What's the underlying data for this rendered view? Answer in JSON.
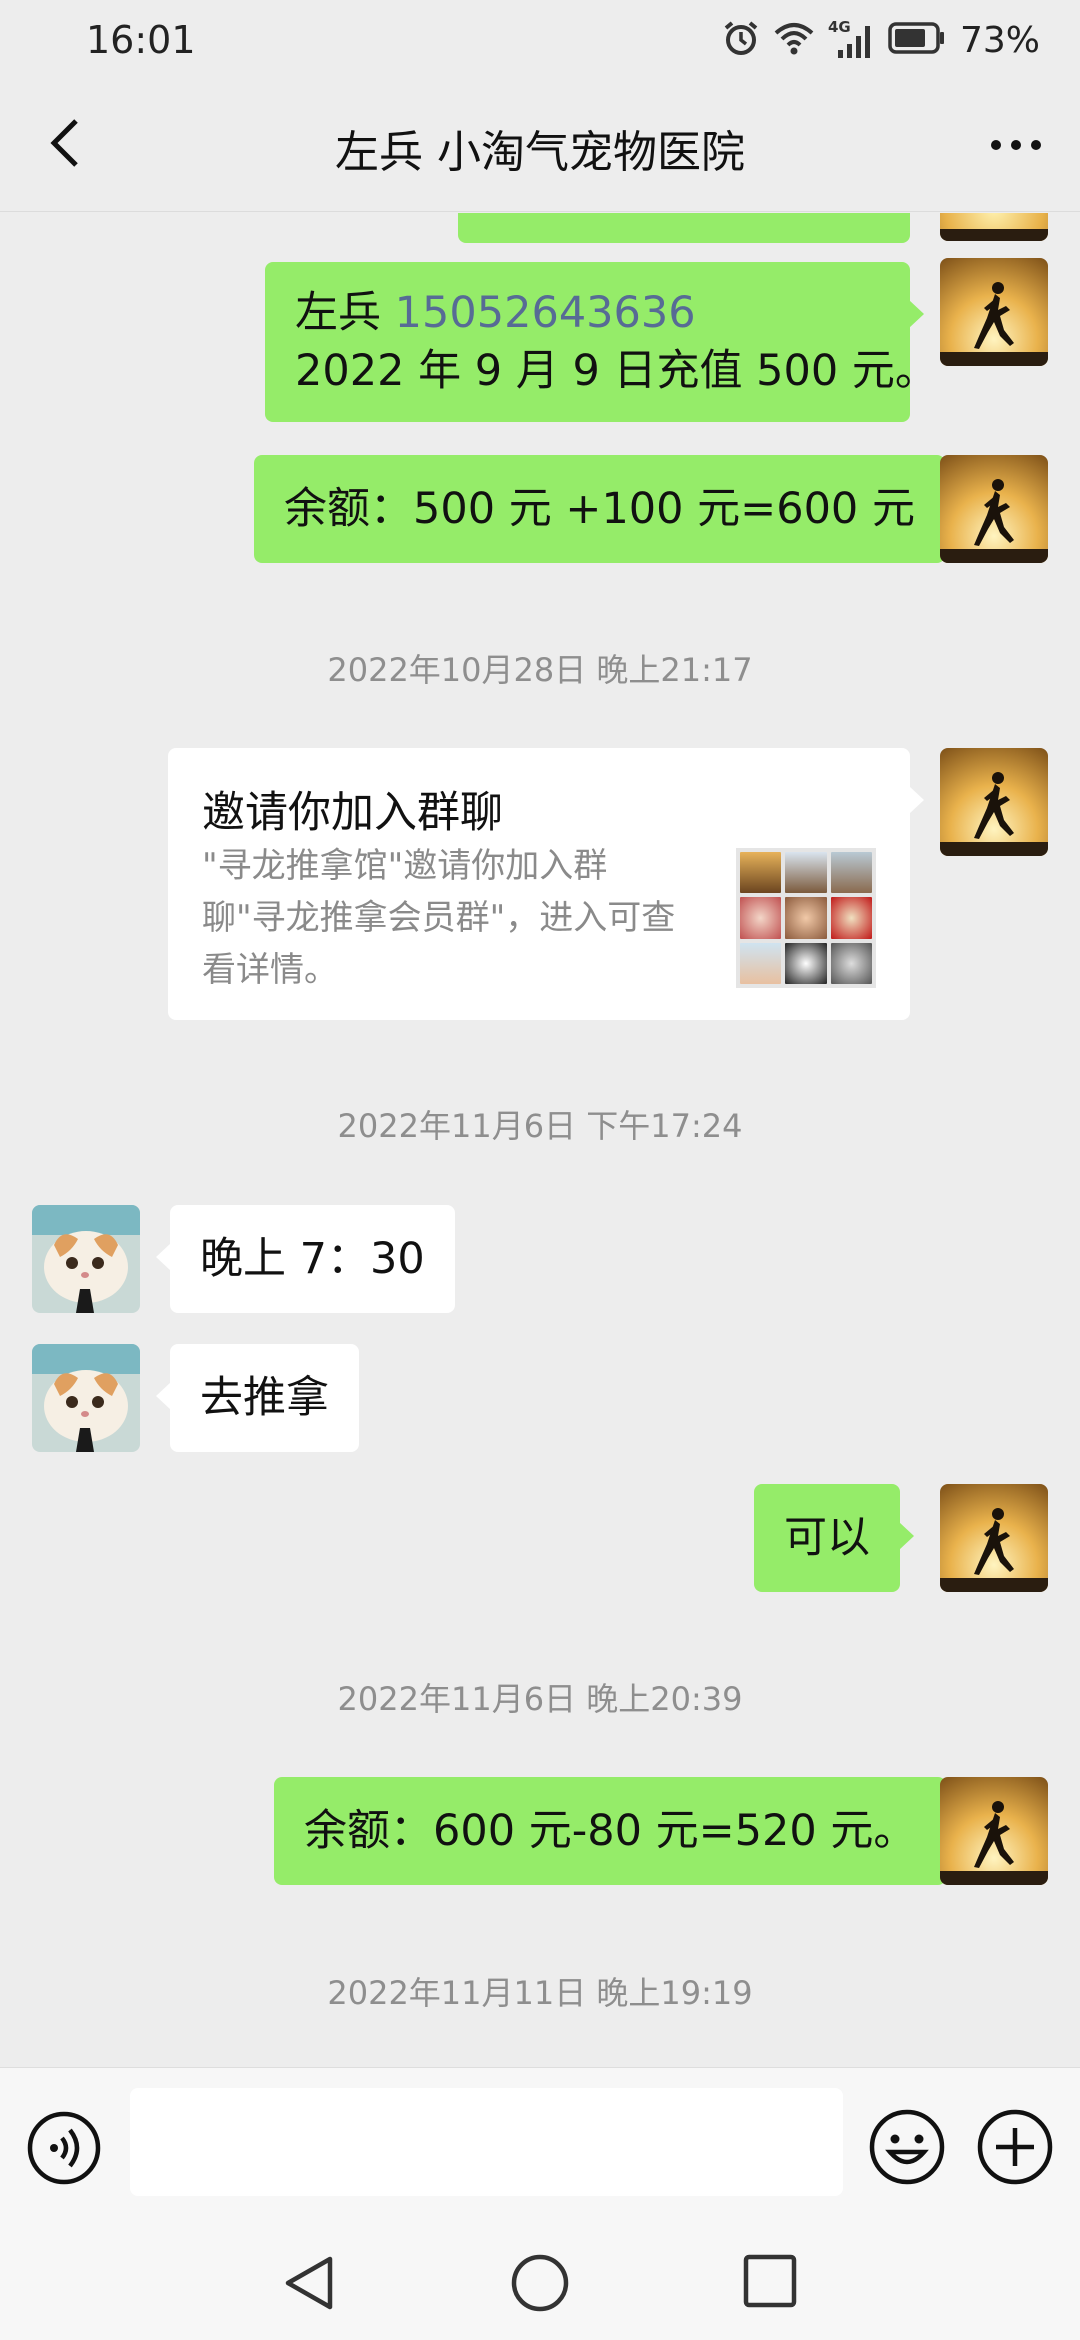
{
  "status_bar": {
    "time": "16:01",
    "signal_label": "4G",
    "battery_percent": "73%",
    "icons": [
      "alarm-icon",
      "wifi-icon",
      "signal-icon",
      "battery-icon"
    ]
  },
  "header": {
    "title": "左兵 小淘气宠物医院",
    "back_icon": "chevron-left-icon",
    "more_icon": "more-dots-icon"
  },
  "messages": {
    "msg_recharge_name": "左兵",
    "msg_recharge_phone": "15052643636",
    "msg_recharge_line2": "2022 年 9 月 9 日充值 500 元。",
    "msg_balance1": "余额：500 元 +100 元=600 元",
    "timestamp1": "2022年10月28日 晚上21:17",
    "invite_title": "邀请你加入群聊",
    "invite_line1": "\"寻龙推拿馆\"邀请你加入群",
    "invite_line2": "聊\"寻龙推拿会员群\"，进入可查",
    "invite_line3": "看详情。",
    "timestamp2": "2022年11月6日 下午17:24",
    "msg_time": "晚上 7：30",
    "msg_massage": "去推拿",
    "msg_ok": "可以",
    "timestamp3": "2022年11月6日 晚上20:39",
    "msg_balance2": "余额：600 元-80 元=520 元。",
    "timestamp4": "2022年11月11日 晚上19:19"
  },
  "input_bar": {
    "input_value": "",
    "icons": [
      "voice-icon",
      "emoji-icon",
      "plus-icon"
    ]
  },
  "nav_bar": {
    "icons": [
      "nav-back-icon",
      "nav-home-icon",
      "nav-recent-icon"
    ]
  },
  "colors": {
    "background": "#ededed",
    "bubble_self": "#95ec69",
    "bubble_other": "#ffffff",
    "link": "#576b95",
    "timestamp": "#8e8e8e"
  }
}
